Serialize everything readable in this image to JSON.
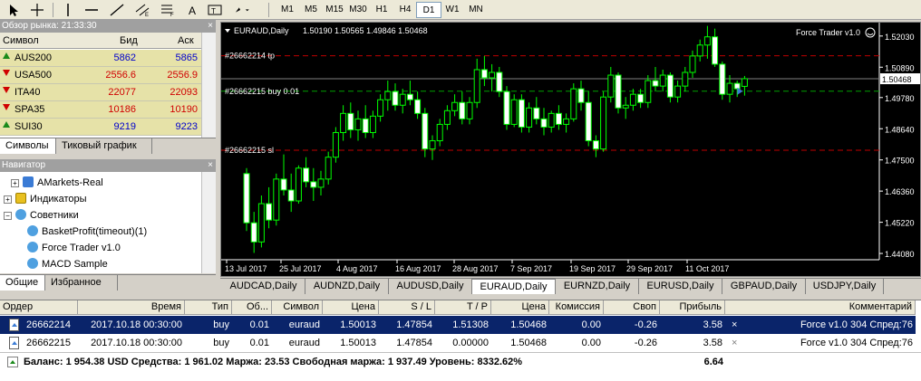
{
  "toolbar": {
    "timeframes": [
      "M1",
      "M5",
      "M15",
      "M30",
      "H1",
      "H4",
      "D1",
      "W1",
      "MN"
    ],
    "active_timeframe": "D1"
  },
  "market_watch": {
    "title": "Обзор рынка: 21:33:30",
    "close": "×",
    "col_symbol": "Символ",
    "col_bid": "Бид",
    "col_ask": "Аск",
    "rows": [
      {
        "symbol": "AUS200",
        "bid": "5862",
        "ask": "5865",
        "dir": "up",
        "color": "#0000cc"
      },
      {
        "symbol": "USA500",
        "bid": "2556.6",
        "ask": "2556.9",
        "dir": "dn",
        "color": "#d00000"
      },
      {
        "symbol": "ITA40",
        "bid": "22077",
        "ask": "22093",
        "dir": "dn",
        "color": "#d00000"
      },
      {
        "symbol": "SPA35",
        "bid": "10186",
        "ask": "10190",
        "dir": "dn",
        "color": "#d00000"
      },
      {
        "symbol": "SUI30",
        "bid": "9219",
        "ask": "9223",
        "dir": "up",
        "color": "#0000cc"
      }
    ],
    "tabs": [
      "Символы",
      "Тиковый график"
    ]
  },
  "navigator": {
    "title": "Навигатор",
    "close": "×",
    "items": [
      {
        "label": "AMarkets-Real"
      },
      {
        "label": "Индикаторы"
      },
      {
        "label": "Советники"
      },
      {
        "label": "BasketProfit(timeout)(1)"
      },
      {
        "label": "Force Trader v1.0"
      },
      {
        "label": "MACD Sample"
      }
    ],
    "tabs": [
      "Общие",
      "Избранное"
    ]
  },
  "chart_data": {
    "type": "candlestick",
    "title": "EURAUD,Daily",
    "ohlc_header": "1.50190 1.50565 1.49846 1.50468",
    "expert_label": "Force Trader v1.0",
    "y_ticks": [
      "1.52030",
      "1.50890",
      "1.50468",
      "1.49780",
      "1.48640",
      "1.47500",
      "1.46360",
      "1.45220",
      "1.44080"
    ],
    "current_price": "1.50468",
    "x_ticks": [
      "13 Jul 2017",
      "25 Jul 2017",
      "4 Aug 2017",
      "16 Aug 2017",
      "28 Aug 2017",
      "7 Sep 2017",
      "19 Sep 2017",
      "29 Sep 2017",
      "11 Oct 2017"
    ],
    "ylim": [
      1.4385,
      1.5252
    ],
    "order_lines": [
      {
        "label": "#26662214 tp",
        "price": 1.51308
      },
      {
        "label": "#26662215 buy 0.01",
        "price": 1.50013
      },
      {
        "label": "#26662215 sl",
        "price": 1.47854
      }
    ],
    "candles": [
      [
        1.47,
        1.472,
        1.449,
        1.452
      ],
      [
        1.452,
        1.456,
        1.441,
        1.445
      ],
      [
        1.445,
        1.462,
        1.443,
        1.459
      ],
      [
        1.459,
        1.465,
        1.45,
        1.453
      ],
      [
        1.453,
        1.47,
        1.451,
        1.468
      ],
      [
        1.468,
        1.477,
        1.462,
        1.464
      ],
      [
        1.464,
        1.47,
        1.456,
        1.46
      ],
      [
        1.46,
        1.473,
        1.459,
        1.472
      ],
      [
        1.472,
        1.476,
        1.465,
        1.467
      ],
      [
        1.467,
        1.472,
        1.46,
        1.465
      ],
      [
        1.465,
        1.471,
        1.462,
        1.468
      ],
      [
        1.468,
        1.478,
        1.466,
        1.476
      ],
      [
        1.476,
        1.487,
        1.474,
        1.485
      ],
      [
        1.485,
        1.495,
        1.482,
        1.492
      ],
      [
        1.492,
        1.496,
        1.483,
        1.486
      ],
      [
        1.486,
        1.493,
        1.482,
        1.49
      ],
      [
        1.49,
        1.495,
        1.483,
        1.485
      ],
      [
        1.485,
        1.493,
        1.483,
        1.491
      ],
      [
        1.491,
        1.499,
        1.489,
        1.497
      ],
      [
        1.497,
        1.504,
        1.493,
        1.5
      ],
      [
        1.5,
        1.503,
        1.493,
        1.495
      ],
      [
        1.495,
        1.501,
        1.492,
        1.499
      ],
      [
        1.499,
        1.504,
        1.495,
        1.497
      ],
      [
        1.497,
        1.5,
        1.49,
        1.492
      ],
      [
        1.492,
        1.494,
        1.476,
        1.479
      ],
      [
        1.479,
        1.484,
        1.475,
        1.482
      ],
      [
        1.482,
        1.49,
        1.48,
        1.488
      ],
      [
        1.488,
        1.495,
        1.486,
        1.493
      ],
      [
        1.493,
        1.499,
        1.491,
        1.496
      ],
      [
        1.496,
        1.5,
        1.488,
        1.49
      ],
      [
        1.49,
        1.498,
        1.488,
        1.496
      ],
      [
        1.496,
        1.512,
        1.494,
        1.508
      ],
      [
        1.508,
        1.513,
        1.502,
        1.505
      ],
      [
        1.505,
        1.51,
        1.5,
        1.507
      ],
      [
        1.507,
        1.509,
        1.498,
        1.5
      ],
      [
        1.5,
        1.502,
        1.486,
        1.488
      ],
      [
        1.488,
        1.499,
        1.487,
        1.497
      ],
      [
        1.497,
        1.499,
        1.485,
        1.487
      ],
      [
        1.487,
        1.496,
        1.485,
        1.494
      ],
      [
        1.494,
        1.498,
        1.488,
        1.49
      ],
      [
        1.49,
        1.494,
        1.484,
        1.487
      ],
      [
        1.487,
        1.493,
        1.485,
        1.492
      ],
      [
        1.492,
        1.495,
        1.486,
        1.488
      ],
      [
        1.488,
        1.492,
        1.485,
        1.49
      ],
      [
        1.49,
        1.503,
        1.489,
        1.501
      ],
      [
        1.501,
        1.504,
        1.493,
        1.496
      ],
      [
        1.496,
        1.5,
        1.48,
        1.482
      ],
      [
        1.482,
        1.484,
        1.476,
        1.479
      ],
      [
        1.479,
        1.5,
        1.478,
        1.498
      ],
      [
        1.498,
        1.509,
        1.496,
        1.506
      ],
      [
        1.506,
        1.507,
        1.492,
        1.494
      ],
      [
        1.494,
        1.498,
        1.49,
        1.495
      ],
      [
        1.495,
        1.501,
        1.493,
        1.499
      ],
      [
        1.499,
        1.501,
        1.494,
        1.496
      ],
      [
        1.496,
        1.506,
        1.494,
        1.504
      ],
      [
        1.504,
        1.509,
        1.5,
        1.502
      ],
      [
        1.502,
        1.508,
        1.5,
        1.506
      ],
      [
        1.506,
        1.507,
        1.496,
        1.498
      ],
      [
        1.498,
        1.504,
        1.496,
        1.502
      ],
      [
        1.502,
        1.509,
        1.5,
        1.507
      ],
      [
        1.507,
        1.515,
        1.505,
        1.513
      ],
      [
        1.513,
        1.519,
        1.511,
        1.517
      ],
      [
        1.517,
        1.524,
        1.512,
        1.52
      ],
      [
        1.52,
        1.523,
        1.509,
        1.51
      ],
      [
        1.51,
        1.511,
        1.497,
        1.499
      ],
      [
        1.499,
        1.506,
        1.496,
        1.503
      ],
      [
        1.503,
        1.504,
        1.498,
        1.501
      ],
      [
        1.5019,
        1.5057,
        1.4985,
        1.5047
      ]
    ]
  },
  "chart_tabs": [
    "AUDCAD,Daily",
    "AUDNZD,Daily",
    "AUDUSD,Daily",
    "EURAUD,Daily",
    "EURNZD,Daily",
    "EURUSD,Daily",
    "GBPAUD,Daily",
    "USDJPY,Daily"
  ],
  "active_chart_tab": "EURAUD,Daily",
  "terminal": {
    "columns": [
      "Ордер",
      "Время",
      "Тип",
      "Об...",
      "Символ",
      "Цена",
      "S / L",
      "T / P",
      "Цена",
      "Комиссия",
      "Своп",
      "Прибыль",
      "Комментарий"
    ],
    "rows": [
      {
        "order": "26662214",
        "time": "2017.10.18 00:30:00",
        "type": "buy",
        "volume": "0.01",
        "symbol": "euraud",
        "price": "1.50013",
        "sl": "1.47854",
        "tp": "1.51308",
        "cur": "1.50468",
        "commission": "0.00",
        "swap": "-0.26",
        "profit": "3.58",
        "close": "×",
        "comment": "Force v1.0 304 Спред:76"
      },
      {
        "order": "26662215",
        "time": "2017.10.18 00:30:00",
        "type": "buy",
        "volume": "0.01",
        "symbol": "euraud",
        "price": "1.50013",
        "sl": "1.47854",
        "tp": "0.00000",
        "cur": "1.50468",
        "commission": "0.00",
        "swap": "-0.26",
        "profit": "3.58",
        "close": "×",
        "comment": "Force v1.0 304 Спред:76"
      }
    ],
    "summary": "Баланс: 1 954.38 USD  Средства: 1 961.02  Маржа: 23.53  Свободная маржа: 1 937.49  Уровень: 8332.62%",
    "total_profit": "6.64"
  }
}
